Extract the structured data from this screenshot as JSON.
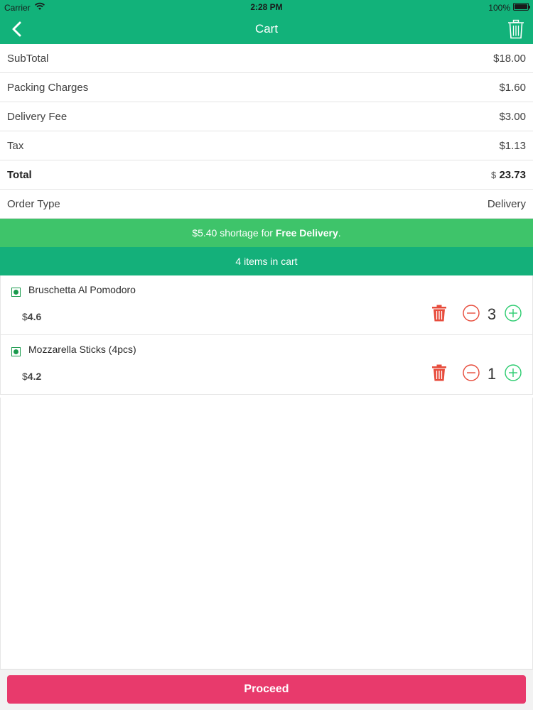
{
  "status_bar": {
    "carrier": "Carrier",
    "time": "2:28 PM",
    "battery": "100%"
  },
  "nav": {
    "title": "Cart",
    "back_icon": "chevron-left-icon",
    "trash_icon": "trash-icon"
  },
  "summary": {
    "subtotal_label": "SubTotal",
    "subtotal_value": "$18.00",
    "packing_label": "Packing Charges",
    "packing_value": "$1.60",
    "delivery_label": "Delivery Fee",
    "delivery_value": "$3.00",
    "tax_label": "Tax",
    "tax_value": "$1.13",
    "total_label": "Total",
    "total_currency": "$",
    "total_value": "23.73",
    "order_type_label": "Order Type",
    "order_type_value": "Delivery"
  },
  "banner": {
    "shortage_prefix": "$5.40 shortage for ",
    "shortage_bold": "Free Delivery",
    "shortage_suffix": ".",
    "items_count": "4 items in cart"
  },
  "items": [
    {
      "name": "Bruschetta Al Pomodoro",
      "currency": "$",
      "price": "4.6",
      "qty": "3"
    },
    {
      "name": "Mozzarella Sticks (4pcs)",
      "currency": "$",
      "price": "4.2",
      "qty": "1"
    }
  ],
  "footer": {
    "proceed_label": "Proceed"
  },
  "colors": {
    "header_green": "#12b27a",
    "shortage_green": "#3ec46a",
    "delete_red": "#e74c3c",
    "plus_green": "#2ecc71",
    "proceed_pink": "#e83a6c",
    "veg_green": "#1a9b4d"
  }
}
